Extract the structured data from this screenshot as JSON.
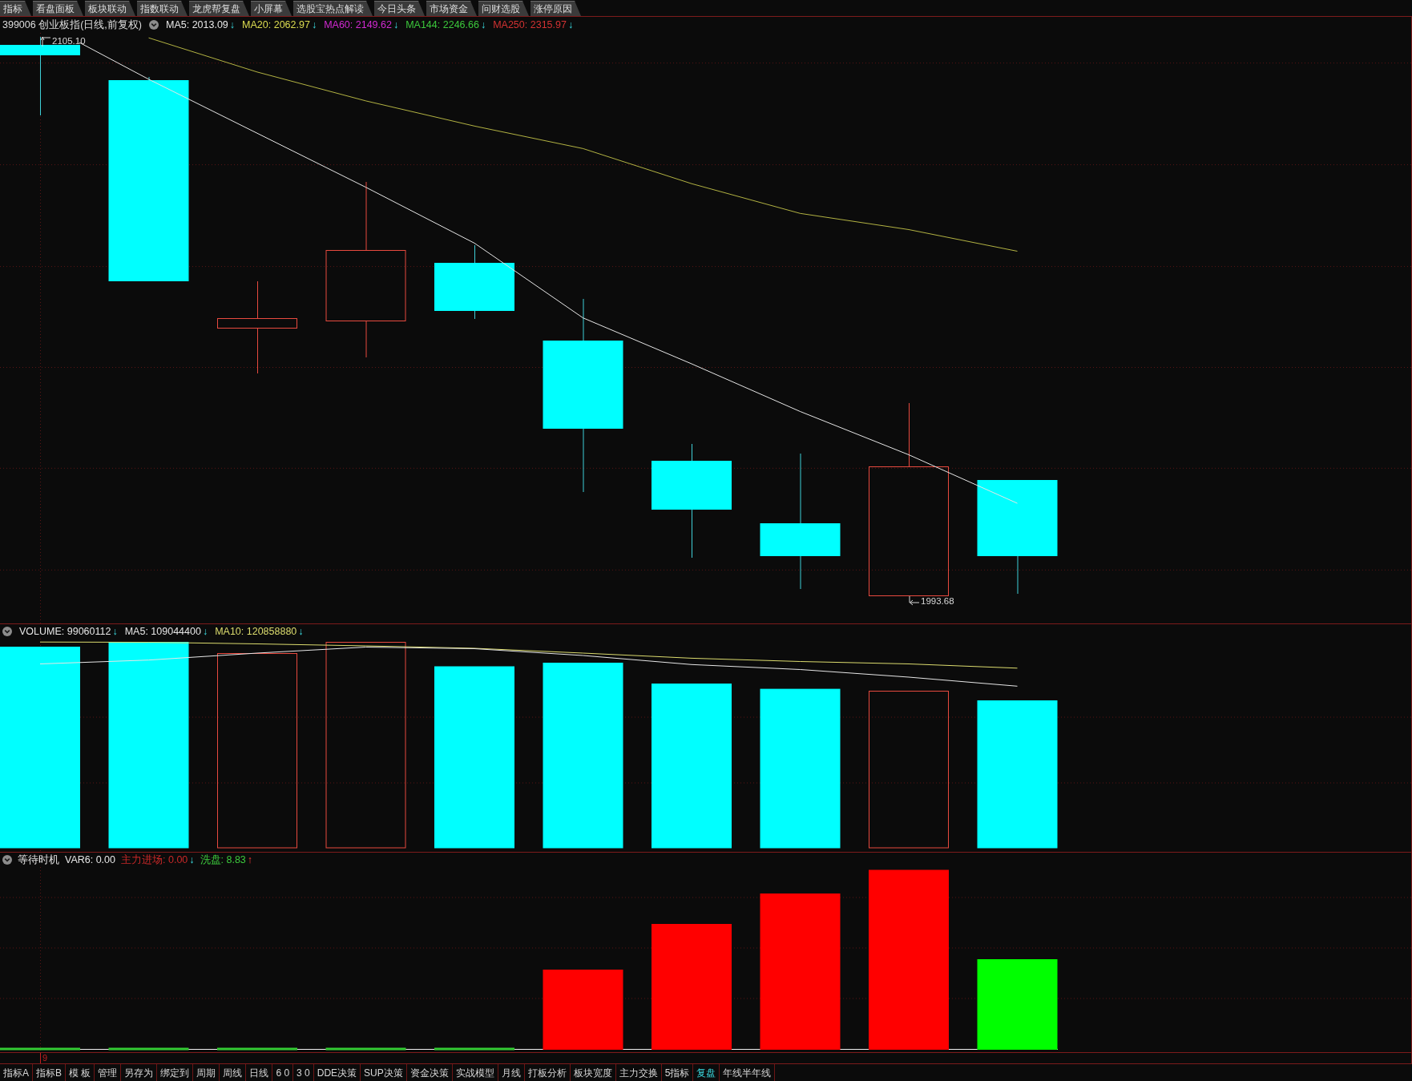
{
  "tabs": [
    {
      "label": "指标",
      "selected": false
    },
    {
      "label": "看盘面板",
      "selected": false
    },
    {
      "label": "板块联动",
      "selected": false
    },
    {
      "label": "指数联动",
      "selected": false
    },
    {
      "label": "龙虎帮复盘",
      "selected": false
    },
    {
      "label": "小屏幕",
      "selected": false
    },
    {
      "label": "选股宝热点解读",
      "selected": false
    },
    {
      "label": "今日头条",
      "selected": false
    },
    {
      "label": "市场资金",
      "selected": false
    },
    {
      "label": "问财选股",
      "selected": false
    },
    {
      "label": "涨停原因",
      "selected": false
    }
  ],
  "price_panel": {
    "title": "399006 创业板指(日线,前复权)",
    "indicators": [
      {
        "label": "MA5: 2013.09",
        "color": "#e6e6e6",
        "arrow": "↓",
        "rising": false
      },
      {
        "label": "MA20: 2062.97",
        "color": "#dcdc50",
        "arrow": "↓",
        "rising": false
      },
      {
        "label": "MA60: 2149.62",
        "color": "#d22ad2",
        "arrow": "↓",
        "rising": false
      },
      {
        "label": "MA144: 2246.66",
        "color": "#3cc83c",
        "arrow": "↓",
        "rising": false
      },
      {
        "label": "MA250: 2315.97",
        "color": "#d23232",
        "arrow": "↓",
        "rising": false
      }
    ],
    "high_label": "2105.10",
    "low_label": "1993.68"
  },
  "volume_panel": {
    "indicators": [
      {
        "label": "VOLUME: 99060112",
        "color": "#e6e6e6",
        "arrow": "↓",
        "rising": false
      },
      {
        "label": "MA5: 109044400",
        "color": "#e6e6e6",
        "arrow": "↓",
        "rising": false
      },
      {
        "label": "MA10: 120858880",
        "color": "#dcdc6e",
        "arrow": "↓",
        "rising": false
      }
    ]
  },
  "indicator_panel": {
    "name": "等待时机",
    "indicators": [
      {
        "label": "VAR6: 0.00",
        "color": "#e6e6e6"
      },
      {
        "label": "主力进场: 0.00",
        "color": "#c82828",
        "arrow": "↓",
        "rising": false
      },
      {
        "label": "洗盘: 8.83",
        "color": "#3cc83c",
        "arrow": "↑",
        "rising": true
      }
    ]
  },
  "x_axis": {
    "labels": [
      "9"
    ]
  },
  "toolbar": [
    {
      "label": "指标A",
      "selected": false
    },
    {
      "label": "指标B",
      "selected": false
    },
    {
      "label": "模 板",
      "selected": false
    },
    {
      "label": "管理",
      "selected": false
    },
    {
      "label": "另存为",
      "selected": false
    },
    {
      "label": "绑定到",
      "selected": false
    },
    {
      "label": "周期",
      "selected": false
    },
    {
      "label": "周线",
      "selected": false
    },
    {
      "label": "日线",
      "selected": false
    },
    {
      "label": "6 0",
      "selected": false
    },
    {
      "label": "3 0",
      "selected": false
    },
    {
      "label": "DDE决策",
      "selected": false
    },
    {
      "label": "SUP决策",
      "selected": false
    },
    {
      "label": "资金决策",
      "selected": false
    },
    {
      "label": "实战模型",
      "selected": false
    },
    {
      "label": "月线",
      "selected": false
    },
    {
      "label": "打板分析",
      "selected": false
    },
    {
      "label": "板块宽度",
      "selected": false
    },
    {
      "label": "主力交换",
      "selected": false
    },
    {
      "label": "5指标",
      "selected": false
    },
    {
      "label": "复盘",
      "selected": true
    },
    {
      "label": "年线半年线",
      "selected": false
    }
  ]
}
